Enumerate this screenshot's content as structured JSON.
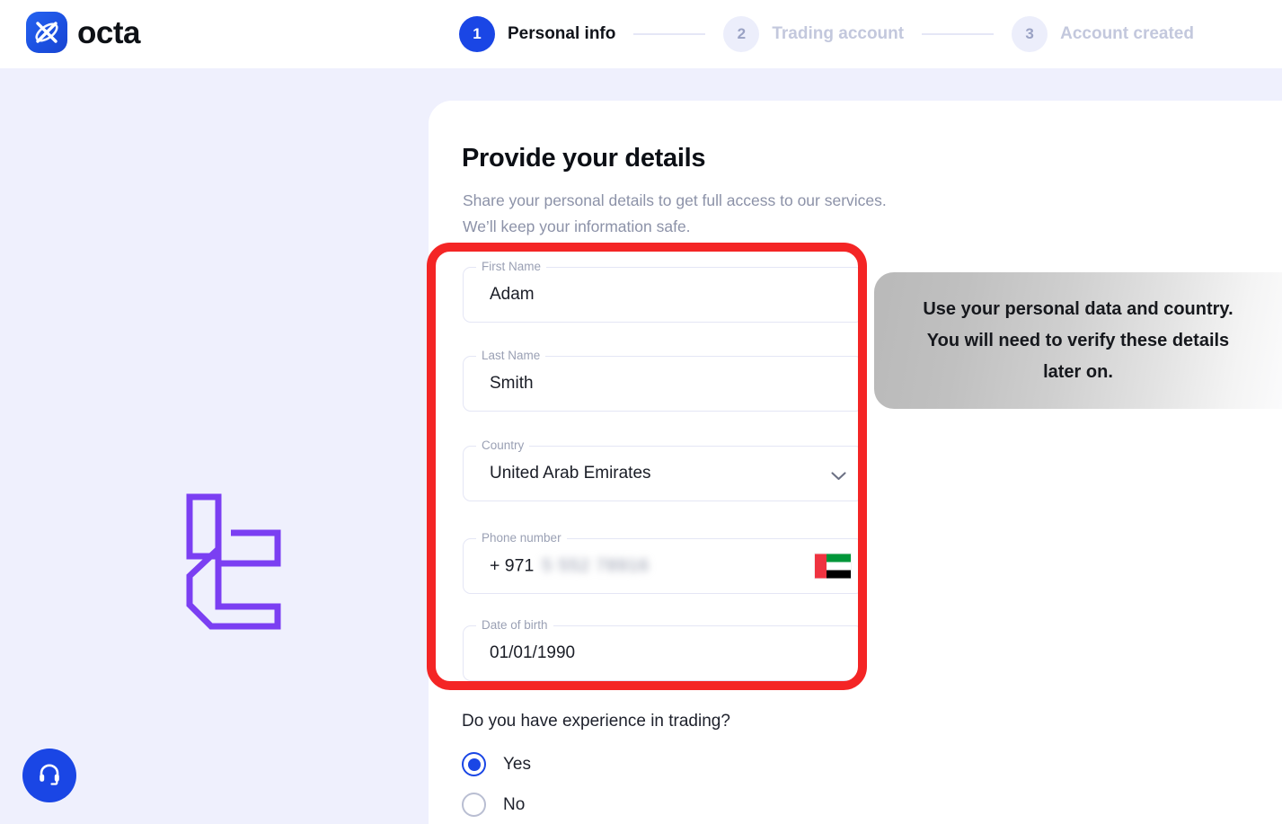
{
  "brand": {
    "name": "octa",
    "logo_icon": "octa-logo-icon",
    "accent_color": "#1a46e5"
  },
  "stepper": {
    "steps": [
      {
        "number": "1",
        "label": "Personal info",
        "state": "active"
      },
      {
        "number": "2",
        "label": "Trading account",
        "state": "idle"
      },
      {
        "number": "3",
        "label": "Account created",
        "state": "idle"
      }
    ]
  },
  "form": {
    "title": "Provide your details",
    "subtitle_line1": "Share your personal details to get full access to our services.",
    "subtitle_line2": "We’ll keep your information safe.",
    "fields": {
      "first_name": {
        "label": "First Name",
        "value": "Adam"
      },
      "last_name": {
        "label": "Last Name",
        "value": "Smith"
      },
      "country": {
        "label": "Country",
        "value": "United Arab Emirates",
        "icon": "chevron-down-icon"
      },
      "phone": {
        "label": "Phone number",
        "prefix": "+ 971",
        "masked_value": "5 552 78916",
        "flag": "uae-flag-icon"
      },
      "date_of_birth": {
        "label": "Date of birth",
        "value": "01/01/1990"
      }
    },
    "experience_question": {
      "label": "Do you have experience in trading?",
      "options": [
        {
          "label": "Yes",
          "selected": true
        },
        {
          "label": "No",
          "selected": false
        }
      ]
    }
  },
  "tooltip": {
    "text": "Use your personal data and country. You will need to verify these details later on."
  },
  "annotation": {
    "highlight_color": "#f42525"
  },
  "support": {
    "icon": "headset-icon"
  },
  "decoration": {
    "icon": "purple-abstract-glyph",
    "color": "#7b3ff2"
  }
}
